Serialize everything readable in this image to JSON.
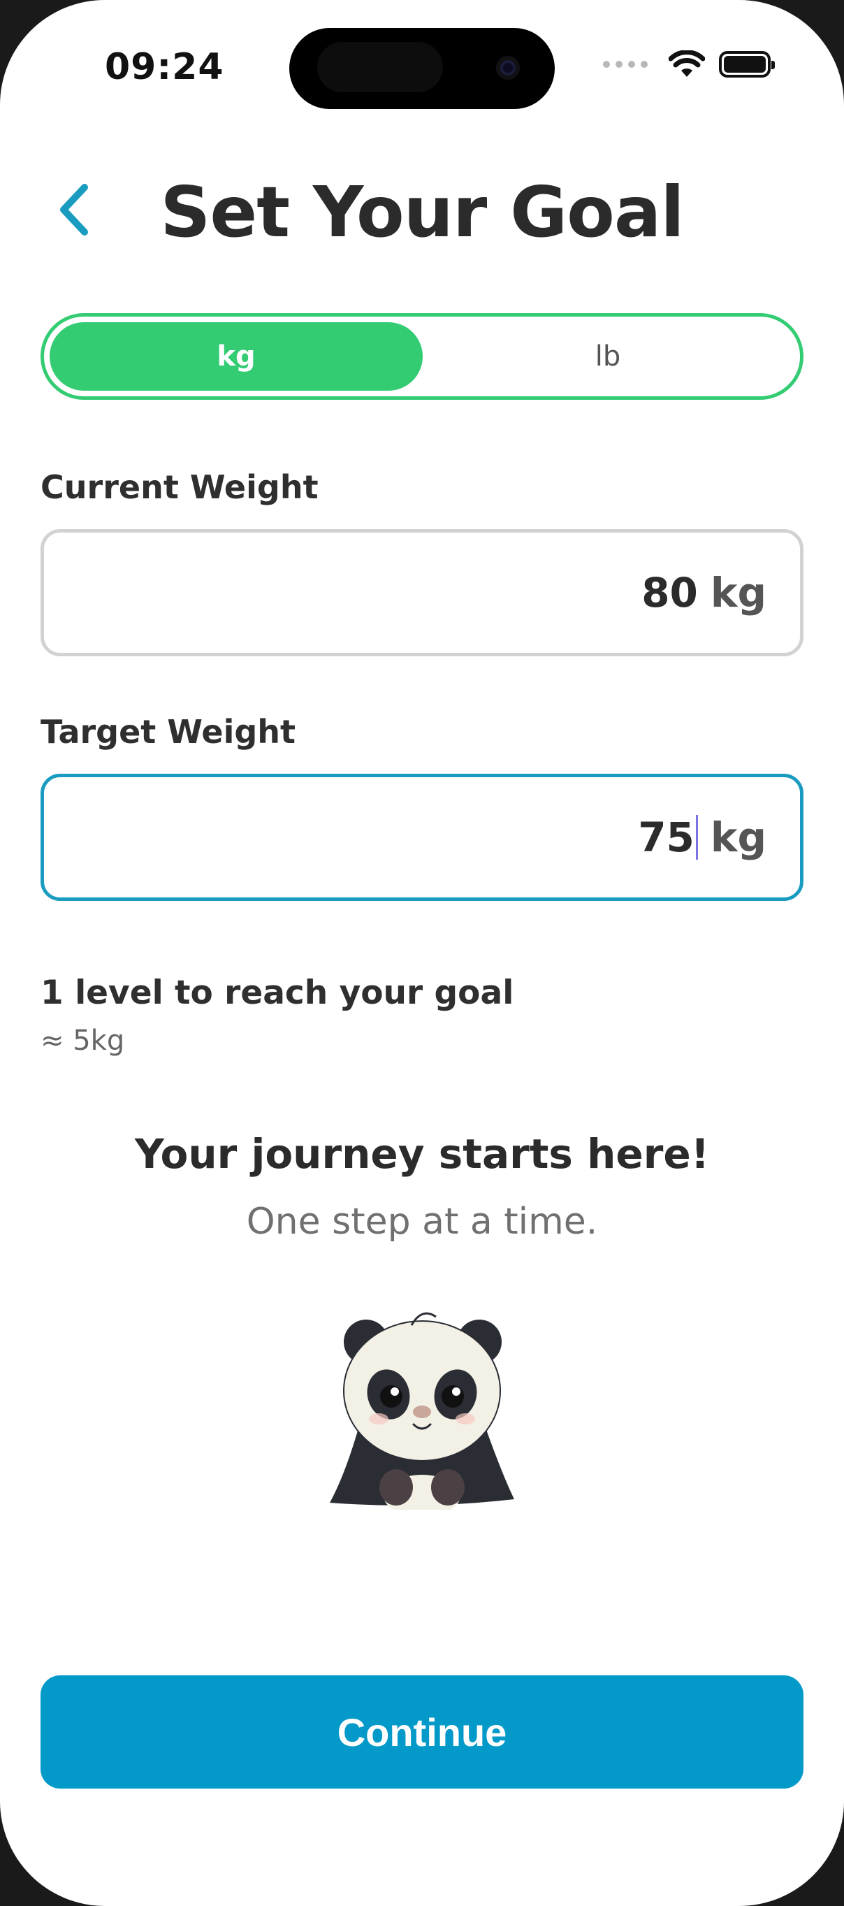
{
  "status_bar": {
    "time": "09:24",
    "signal_icon": "cellular-dots-icon",
    "wifi_icon": "wifi-icon",
    "battery_icon": "battery-icon"
  },
  "header": {
    "back_icon": "chevron-left-icon",
    "title": "Set Your Goal"
  },
  "unit_toggle": {
    "options": [
      "kg",
      "lb"
    ],
    "selected": "kg",
    "active_color": "#33cc73"
  },
  "current_weight": {
    "label": "Current Weight",
    "value": "80",
    "unit": "kg"
  },
  "target_weight": {
    "label": "Target Weight",
    "value": "75",
    "unit": "kg",
    "focused_border_color": "#1a9cc0"
  },
  "progress": {
    "levels_text": "1 level to reach your goal",
    "approx_text": "≈ 5kg"
  },
  "motivation": {
    "headline": "Your journey starts here!",
    "subline": "One step at a time.",
    "image_icon": "panda-mascot-icon"
  },
  "continue_button": {
    "label": "Continue",
    "color": "#0399c9"
  }
}
